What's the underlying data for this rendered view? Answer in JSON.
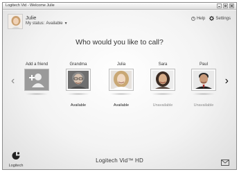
{
  "window": {
    "title": "Logitech Vid - Welcome Julie"
  },
  "user": {
    "name": "Julie",
    "status_prefix": "My status:",
    "status_value": "Available",
    "status_caret": "▼"
  },
  "top_links": {
    "help_label": "Help",
    "settings_label": "Settings"
  },
  "main": {
    "question": "Who would you like to call?"
  },
  "contacts": [
    {
      "name": "Add a friend",
      "availability": "",
      "type": "add"
    },
    {
      "name": "Grandma",
      "availability": "Available",
      "type": "contact"
    },
    {
      "name": "Julia",
      "availability": "Available",
      "type": "contact"
    },
    {
      "name": "Sara",
      "availability": "Unavailable",
      "type": "contact"
    },
    {
      "name": "Paul",
      "availability": "Unavailable",
      "type": "contact"
    }
  ],
  "nav": {
    "prev_glyph": "‹",
    "next_glyph": "›"
  },
  "footer": {
    "brand": "Logitech Vid™ HD",
    "logo_text": "Logitech"
  },
  "colors": {
    "available": "#222222",
    "unavailable": "#8a8a8a",
    "add_tile": "#9a9a9a"
  }
}
